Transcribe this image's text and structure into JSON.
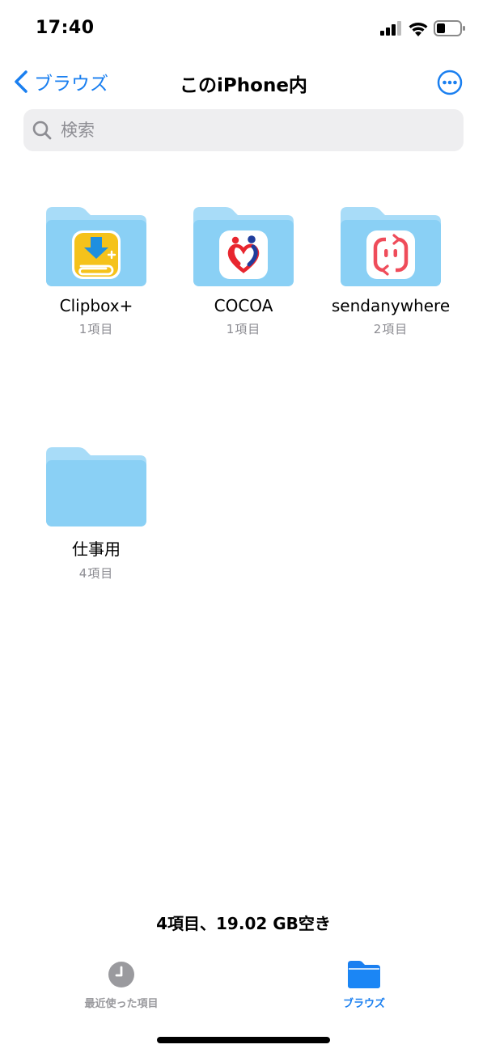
{
  "status_bar": {
    "time": "17:40"
  },
  "nav": {
    "back_label": "ブラウズ",
    "title": "このiPhone内"
  },
  "search": {
    "placeholder": "検索",
    "value": ""
  },
  "folders": [
    {
      "name": "Clipbox+",
      "count": "1項目",
      "icon": "clipbox-app-icon"
    },
    {
      "name": "COCOA",
      "count": "1項目",
      "icon": "cocoa-app-icon"
    },
    {
      "name": "sendanywhere",
      "count": "2項目",
      "icon": "sendanywhere-app-icon"
    },
    {
      "name": "仕事用",
      "count": "4項目",
      "icon": ""
    }
  ],
  "storage_summary": "4項目、19.02 GB空き",
  "tab_bar": {
    "tabs": [
      {
        "label": "最近使った項目",
        "icon": "clock-icon",
        "selected": false
      },
      {
        "label": "ブラウズ",
        "icon": "folder-icon",
        "selected": true
      }
    ]
  },
  "colors": {
    "accent": "#1a7ff0",
    "folder": "#8ad0f5",
    "folder_tab": "#a8dcf8",
    "secondary_text": "#8d8d93",
    "inactive_tab": "#9a9a9e"
  }
}
